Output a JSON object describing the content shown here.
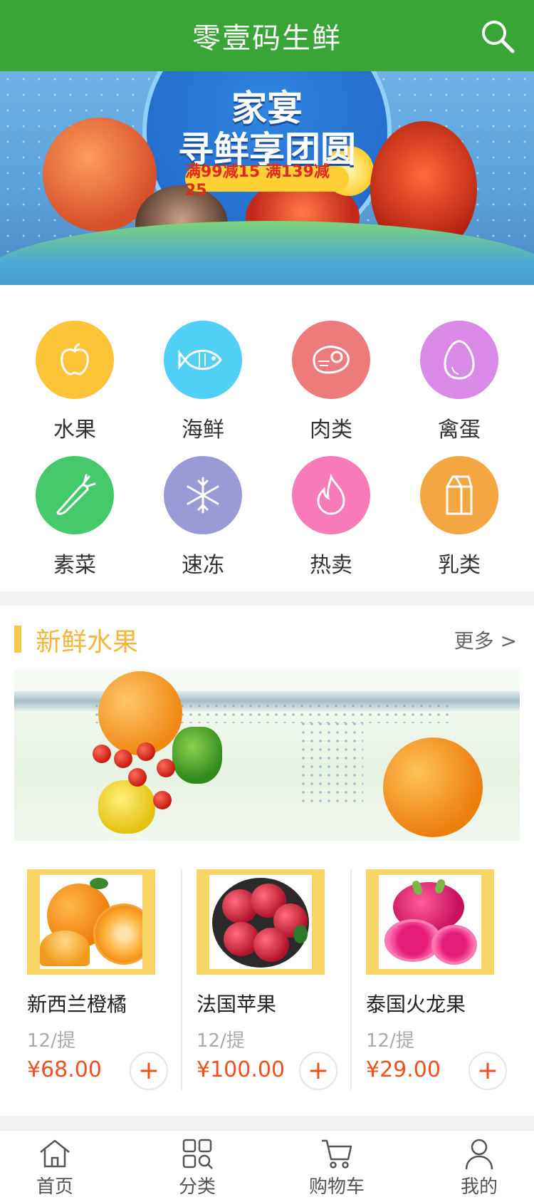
{
  "header": {
    "title": "零壹码生鲜",
    "search_icon": "search-icon"
  },
  "banner": {
    "title_line1": "家宴",
    "title_line2": "寻鲜享团圆",
    "promo": "满99减15 满139减25"
  },
  "categories": [
    {
      "label": "水果",
      "icon": "apple-icon",
      "color": "#fcc436"
    },
    {
      "label": "海鲜",
      "icon": "fish-icon",
      "color": "#50d0f4"
    },
    {
      "label": "肉类",
      "icon": "meat-icon",
      "color": "#ee7b7b"
    },
    {
      "label": "禽蛋",
      "icon": "egg-icon",
      "color": "#d98ae6"
    },
    {
      "label": "素菜",
      "icon": "carrot-icon",
      "color": "#45c96b"
    },
    {
      "label": "速冻",
      "icon": "snowflake-icon",
      "color": "#9a9bd6"
    },
    {
      "label": "热卖",
      "icon": "fire-icon",
      "color": "#f87ab9"
    },
    {
      "label": "乳类",
      "icon": "milk-icon",
      "color": "#f3a642"
    }
  ],
  "fruit_section": {
    "title": "新鲜水果",
    "more": "更多 >"
  },
  "products": [
    {
      "name": "新西兰橙橘",
      "unit": "12/提",
      "price": "¥68.00",
      "add": "+"
    },
    {
      "name": "法国苹果",
      "unit": "12/提",
      "price": "¥100.00",
      "add": "+"
    },
    {
      "name": "泰国火龙果",
      "unit": "12/提",
      "price": "¥29.00",
      "add": "+"
    }
  ],
  "tabbar": [
    {
      "label": "首页",
      "icon": "home-icon"
    },
    {
      "label": "分类",
      "icon": "category-icon"
    },
    {
      "label": "购物车",
      "icon": "cart-icon"
    },
    {
      "label": "我的",
      "icon": "user-icon"
    }
  ],
  "colors": {
    "brand_green": "#3aa537",
    "accent_yellow": "#f6c84a",
    "price_red": "#f24f1d"
  }
}
